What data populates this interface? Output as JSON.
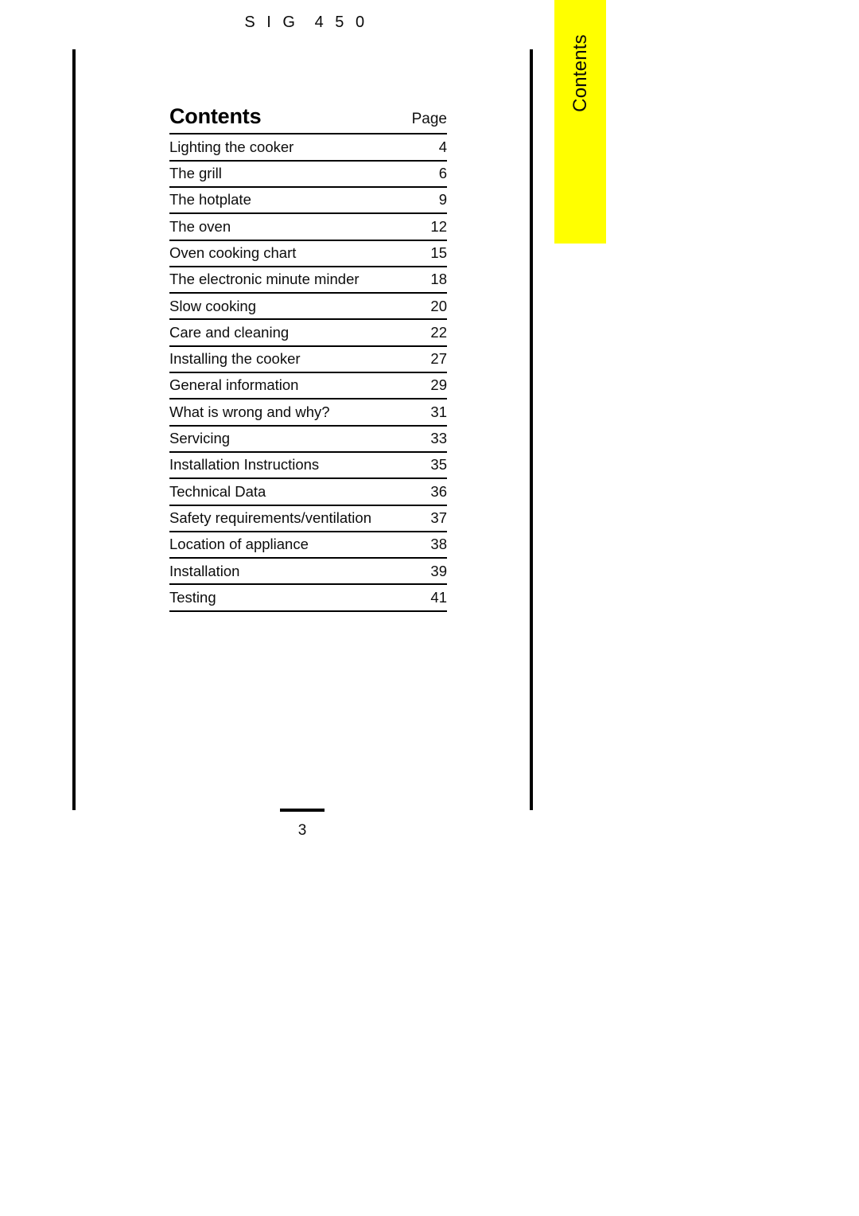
{
  "header": {
    "model": "S I G  4 5 0"
  },
  "thumb_tab": {
    "label": "Contents",
    "color": "#ffff00"
  },
  "contents": {
    "title": "Contents",
    "page_column_label": "Page",
    "entries": [
      {
        "title": "Lighting the cooker",
        "page": "4"
      },
      {
        "title": "The grill",
        "page": "6"
      },
      {
        "title": "The hotplate",
        "page": "9"
      },
      {
        "title": "The oven",
        "page": "12"
      },
      {
        "title": "Oven cooking chart",
        "page": "15"
      },
      {
        "title": "The electronic minute minder",
        "page": "18"
      },
      {
        "title": "Slow cooking",
        "page": "20"
      },
      {
        "title": "Care and cleaning",
        "page": "22"
      },
      {
        "title": "Installing the cooker",
        "page": "27"
      },
      {
        "title": "General information",
        "page": "29"
      },
      {
        "title": "What is wrong and why?",
        "page": "31"
      },
      {
        "title": "Servicing",
        "page": "33"
      },
      {
        "title": "Installation Instructions",
        "page": "35"
      },
      {
        "title": "Technical Data",
        "page": "36"
      },
      {
        "title": "Safety requirements/ventilation",
        "page": "37"
      },
      {
        "title": "Location of appliance",
        "page": "38"
      },
      {
        "title": "Installation",
        "page": "39"
      },
      {
        "title": "Testing",
        "page": "41"
      }
    ]
  },
  "footer": {
    "page_number": "3"
  }
}
